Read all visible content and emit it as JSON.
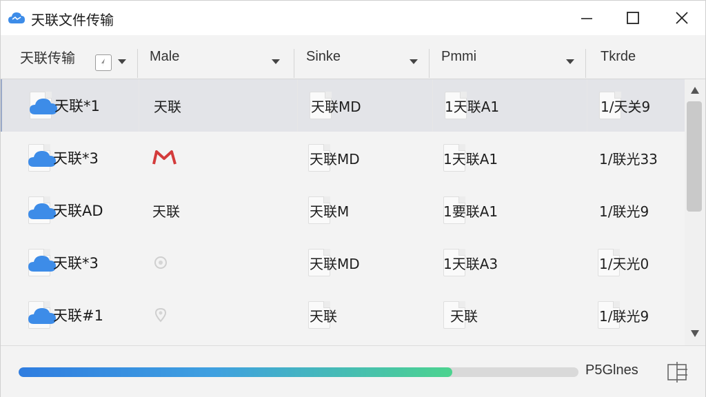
{
  "window": {
    "title": "天联文件传输"
  },
  "header": {
    "columns": [
      {
        "label": "天联传输"
      },
      {
        "label": "Male"
      },
      {
        "label": "Sinke"
      },
      {
        "label": "Pmmi"
      },
      {
        "label": "Tkrde"
      }
    ]
  },
  "rows": [
    {
      "name": "天联*1",
      "col1": "天联",
      "col1_icon": "",
      "col2": "天联MD",
      "col3": "1天联A1",
      "col4": "1/天关9"
    },
    {
      "name": "天联*3",
      "col1": "",
      "col1_icon": "gmail-icon",
      "col2": "天联MD",
      "col3": "1天联A1",
      "col4": "1/联光33"
    },
    {
      "name": "天联AD",
      "col1": "天联",
      "col1_icon": "",
      "col2": "天联M",
      "col3": "1要联A1",
      "col4": "1/联光9"
    },
    {
      "name": "天联*3",
      "col1": "",
      "col1_icon": "pin-icon",
      "col2": "天联MD",
      "col3": "1天联A3",
      "col4": "1/天光0"
    },
    {
      "name": "天联#1",
      "col1": "",
      "col1_icon": "pin-icon",
      "col2": "天联",
      "col3": "天联",
      "col4": "1/联光9"
    }
  ],
  "footer": {
    "status": "P5Glnes",
    "progress": 0.775
  },
  "colors": {
    "accent_start": "#2f7de0",
    "accent_end": "#4cd38f",
    "cloud": "#3d8ce8"
  }
}
